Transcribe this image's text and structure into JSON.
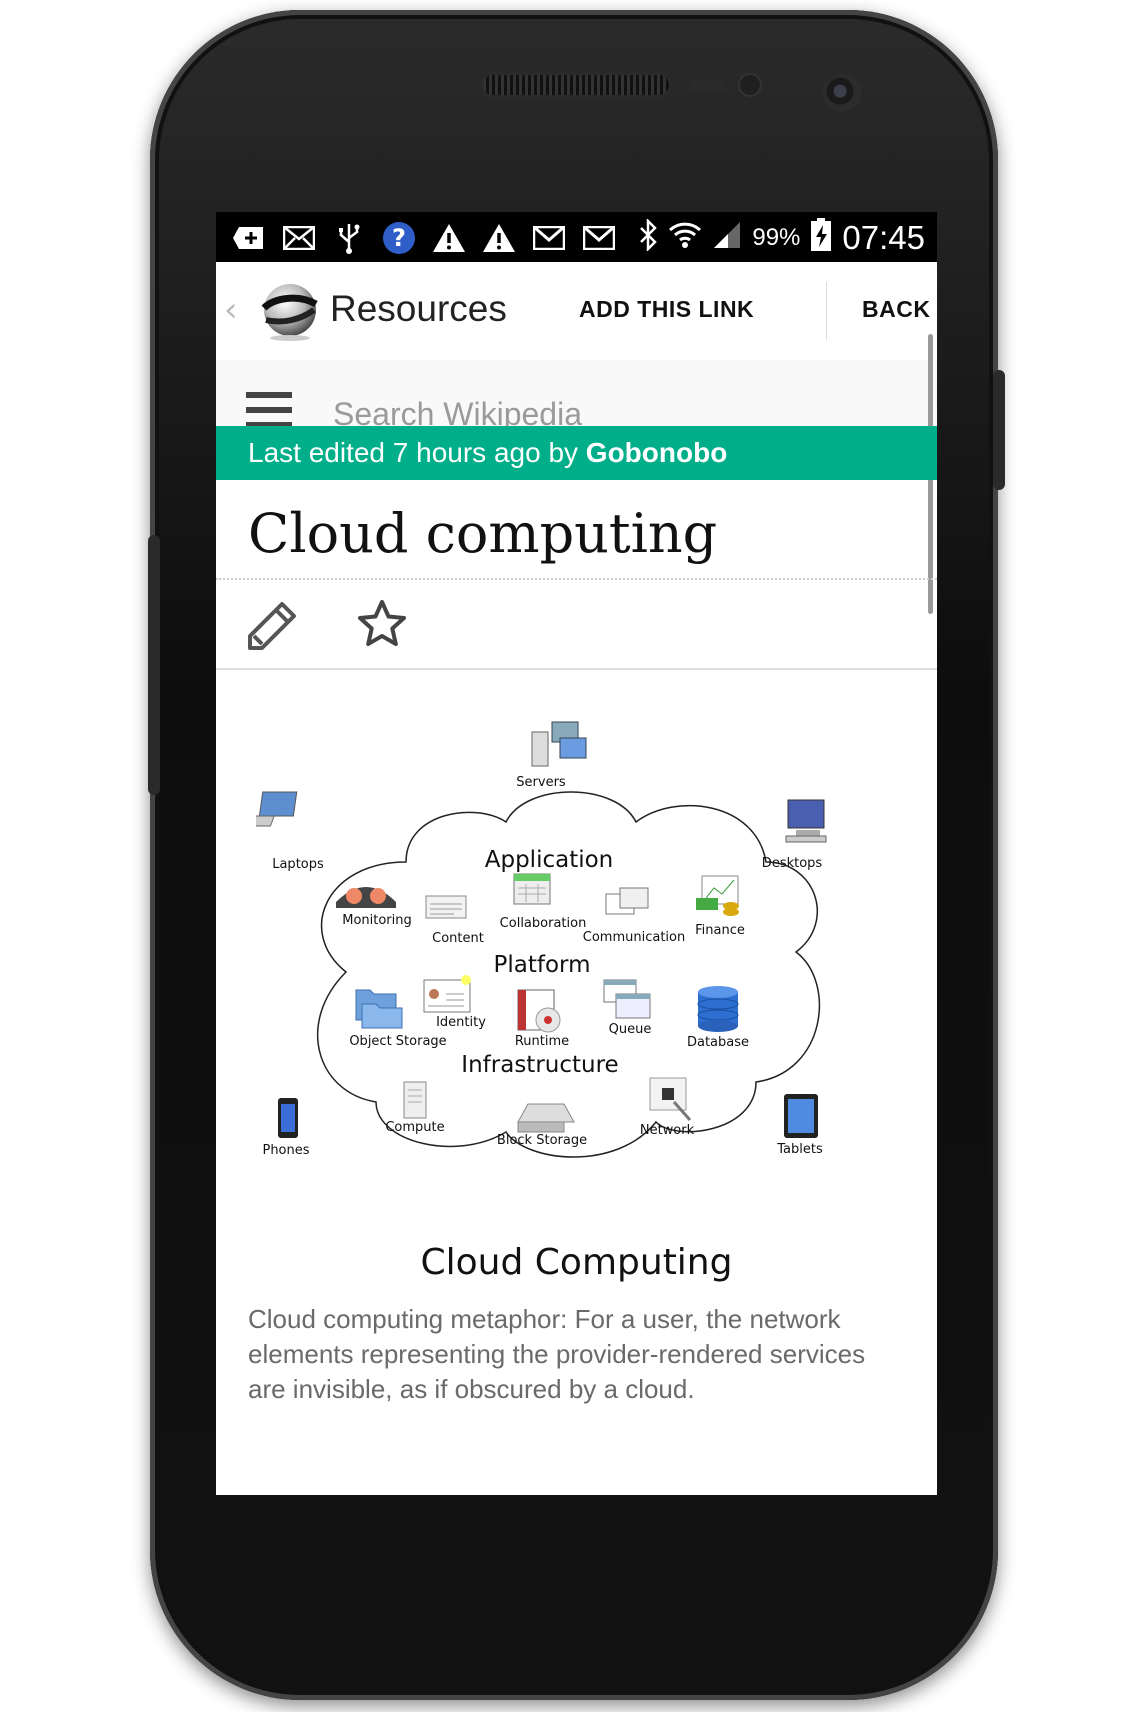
{
  "status_bar": {
    "battery_percent": "99%",
    "time": "07:45",
    "icons": [
      "add-icon",
      "mail-icon",
      "usb-icon",
      "help-icon",
      "warning-icon",
      "warning-icon",
      "gmail-icon",
      "gmail-icon",
      "bluetooth-icon",
      "wifi-icon",
      "signal-icon",
      "battery-charging-icon"
    ]
  },
  "app_bar": {
    "title": "Resources",
    "add_link_label": "ADD THIS LINK",
    "back_label": "BACK"
  },
  "search": {
    "placeholder": "Search Wikipedia"
  },
  "last_edited": {
    "prefix": "Last edited 7 hours ago by ",
    "user": "Gobonobo"
  },
  "article": {
    "title": "Cloud computing",
    "caption": "Cloud computing metaphor: For a user, the network elements representing the provider-rendered services are invisible, as if obscured by a cloud."
  },
  "figure": {
    "title": "Cloud Computing",
    "sections": {
      "application": "Application",
      "platform": "Platform",
      "infrastructure": "Infrastructure"
    },
    "labels": {
      "servers": "Servers",
      "laptops": "Laptops",
      "desktops": "Desktops",
      "monitoring": "Monitoring",
      "content": "Content",
      "collaboration": "Collaboration",
      "communication": "Communication",
      "finance": "Finance",
      "identity": "Identity",
      "object_storage": "Object Storage",
      "runtime": "Runtime",
      "queue": "Queue",
      "database": "Database",
      "compute": "Compute",
      "block_storage": "Block Storage",
      "network": "Network",
      "phones": "Phones",
      "tablets": "Tablets"
    }
  },
  "colors": {
    "accent_green": "#00af89",
    "help_blue": "#2f5ec9"
  }
}
